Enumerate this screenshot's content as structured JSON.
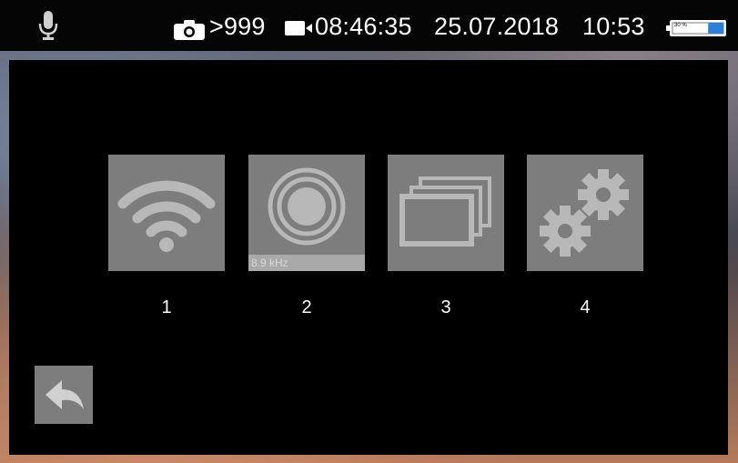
{
  "status_bar": {
    "icons": [
      "mic-icon",
      "camera-icon",
      "video-icon",
      "battery-icon"
    ],
    "photo_count": ">999",
    "record_time": "08:46:35",
    "date": "25.07.2018",
    "clock": "10:53",
    "battery_percent_label": "30 %",
    "battery_level": 0.3
  },
  "menu": {
    "tiles": [
      {
        "icon": "wifi-icon",
        "number": "1"
      },
      {
        "icon": "vibration-icon",
        "number": "2",
        "caption": "8.9 kHz"
      },
      {
        "icon": "gallery-icon",
        "number": "3"
      },
      {
        "icon": "settings-gears-icon",
        "number": "4"
      }
    ],
    "back_icon": "back-arrow-icon"
  },
  "colors": {
    "tile": "#7d7d7d",
    "tile_icon": "#b8b8b8",
    "battery_fill": "#2f7fd6"
  }
}
